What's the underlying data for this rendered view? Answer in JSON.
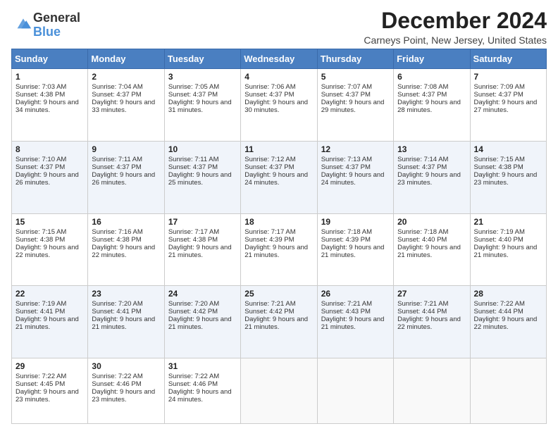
{
  "logo": {
    "general": "General",
    "blue": "Blue"
  },
  "title": "December 2024",
  "location": "Carneys Point, New Jersey, United States",
  "days_header": [
    "Sunday",
    "Monday",
    "Tuesday",
    "Wednesday",
    "Thursday",
    "Friday",
    "Saturday"
  ],
  "weeks": [
    [
      {
        "day": "1",
        "sunrise": "7:03 AM",
        "sunset": "4:38 PM",
        "daylight": "9 hours and 34 minutes."
      },
      {
        "day": "2",
        "sunrise": "7:04 AM",
        "sunset": "4:37 PM",
        "daylight": "9 hours and 33 minutes."
      },
      {
        "day": "3",
        "sunrise": "7:05 AM",
        "sunset": "4:37 PM",
        "daylight": "9 hours and 31 minutes."
      },
      {
        "day": "4",
        "sunrise": "7:06 AM",
        "sunset": "4:37 PM",
        "daylight": "9 hours and 30 minutes."
      },
      {
        "day": "5",
        "sunrise": "7:07 AM",
        "sunset": "4:37 PM",
        "daylight": "9 hours and 29 minutes."
      },
      {
        "day": "6",
        "sunrise": "7:08 AM",
        "sunset": "4:37 PM",
        "daylight": "9 hours and 28 minutes."
      },
      {
        "day": "7",
        "sunrise": "7:09 AM",
        "sunset": "4:37 PM",
        "daylight": "9 hours and 27 minutes."
      }
    ],
    [
      {
        "day": "8",
        "sunrise": "7:10 AM",
        "sunset": "4:37 PM",
        "daylight": "9 hours and 26 minutes."
      },
      {
        "day": "9",
        "sunrise": "7:11 AM",
        "sunset": "4:37 PM",
        "daylight": "9 hours and 26 minutes."
      },
      {
        "day": "10",
        "sunrise": "7:11 AM",
        "sunset": "4:37 PM",
        "daylight": "9 hours and 25 minutes."
      },
      {
        "day": "11",
        "sunrise": "7:12 AM",
        "sunset": "4:37 PM",
        "daylight": "9 hours and 24 minutes."
      },
      {
        "day": "12",
        "sunrise": "7:13 AM",
        "sunset": "4:37 PM",
        "daylight": "9 hours and 24 minutes."
      },
      {
        "day": "13",
        "sunrise": "7:14 AM",
        "sunset": "4:37 PM",
        "daylight": "9 hours and 23 minutes."
      },
      {
        "day": "14",
        "sunrise": "7:15 AM",
        "sunset": "4:38 PM",
        "daylight": "9 hours and 23 minutes."
      }
    ],
    [
      {
        "day": "15",
        "sunrise": "7:15 AM",
        "sunset": "4:38 PM",
        "daylight": "9 hours and 22 minutes."
      },
      {
        "day": "16",
        "sunrise": "7:16 AM",
        "sunset": "4:38 PM",
        "daylight": "9 hours and 22 minutes."
      },
      {
        "day": "17",
        "sunrise": "7:17 AM",
        "sunset": "4:38 PM",
        "daylight": "9 hours and 21 minutes."
      },
      {
        "day": "18",
        "sunrise": "7:17 AM",
        "sunset": "4:39 PM",
        "daylight": "9 hours and 21 minutes."
      },
      {
        "day": "19",
        "sunrise": "7:18 AM",
        "sunset": "4:39 PM",
        "daylight": "9 hours and 21 minutes."
      },
      {
        "day": "20",
        "sunrise": "7:18 AM",
        "sunset": "4:40 PM",
        "daylight": "9 hours and 21 minutes."
      },
      {
        "day": "21",
        "sunrise": "7:19 AM",
        "sunset": "4:40 PM",
        "daylight": "9 hours and 21 minutes."
      }
    ],
    [
      {
        "day": "22",
        "sunrise": "7:19 AM",
        "sunset": "4:41 PM",
        "daylight": "9 hours and 21 minutes."
      },
      {
        "day": "23",
        "sunrise": "7:20 AM",
        "sunset": "4:41 PM",
        "daylight": "9 hours and 21 minutes."
      },
      {
        "day": "24",
        "sunrise": "7:20 AM",
        "sunset": "4:42 PM",
        "daylight": "9 hours and 21 minutes."
      },
      {
        "day": "25",
        "sunrise": "7:21 AM",
        "sunset": "4:42 PM",
        "daylight": "9 hours and 21 minutes."
      },
      {
        "day": "26",
        "sunrise": "7:21 AM",
        "sunset": "4:43 PM",
        "daylight": "9 hours and 21 minutes."
      },
      {
        "day": "27",
        "sunrise": "7:21 AM",
        "sunset": "4:44 PM",
        "daylight": "9 hours and 22 minutes."
      },
      {
        "day": "28",
        "sunrise": "7:22 AM",
        "sunset": "4:44 PM",
        "daylight": "9 hours and 22 minutes."
      }
    ],
    [
      {
        "day": "29",
        "sunrise": "7:22 AM",
        "sunset": "4:45 PM",
        "daylight": "9 hours and 23 minutes."
      },
      {
        "day": "30",
        "sunrise": "7:22 AM",
        "sunset": "4:46 PM",
        "daylight": "9 hours and 23 minutes."
      },
      {
        "day": "31",
        "sunrise": "7:22 AM",
        "sunset": "4:46 PM",
        "daylight": "9 hours and 24 minutes."
      },
      null,
      null,
      null,
      null
    ]
  ],
  "labels": {
    "sunrise": "Sunrise:",
    "sunset": "Sunset:",
    "daylight": "Daylight:"
  }
}
